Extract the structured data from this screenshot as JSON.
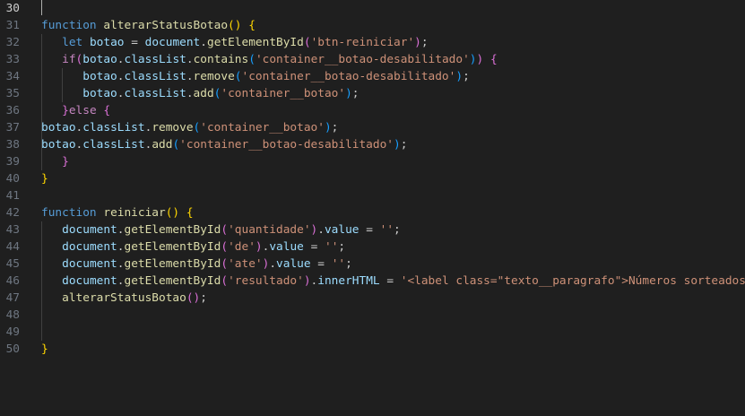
{
  "editor": {
    "colors": {
      "background": "#1f1f1f",
      "keyword": "#569cd6",
      "control": "#c586c0",
      "function": "#dcdcaa",
      "variable": "#9cdcfe",
      "string": "#ce9178",
      "bracket1": "#ffd700",
      "bracket2": "#da70d6",
      "bracket3": "#179fff"
    },
    "lines": [
      {
        "n": "30",
        "active": true,
        "tokens": []
      },
      {
        "n": "31",
        "tokens": [
          [
            "kw",
            "function"
          ],
          [
            "pl",
            " "
          ],
          [
            "fn",
            "alterarStatusBotao"
          ],
          [
            "p1",
            "()"
          ],
          [
            "pl",
            " "
          ],
          [
            "p1",
            "{"
          ]
        ]
      },
      {
        "n": "32",
        "tokens": [
          [
            "pl",
            "   "
          ],
          [
            "kw",
            "let"
          ],
          [
            "pl",
            " "
          ],
          [
            "var",
            "botao"
          ],
          [
            "pl",
            " = "
          ],
          [
            "var",
            "document"
          ],
          [
            "pl",
            "."
          ],
          [
            "fn",
            "getElementById"
          ],
          [
            "p2",
            "("
          ],
          [
            "str",
            "'btn-reiniciar'"
          ],
          [
            "p2",
            ")"
          ],
          [
            "pl",
            ";"
          ]
        ]
      },
      {
        "n": "33",
        "tokens": [
          [
            "pl",
            "   "
          ],
          [
            "kw2",
            "if"
          ],
          [
            "p2",
            "("
          ],
          [
            "var",
            "botao"
          ],
          [
            "pl",
            "."
          ],
          [
            "var",
            "classList"
          ],
          [
            "pl",
            "."
          ],
          [
            "fn",
            "contains"
          ],
          [
            "p3",
            "("
          ],
          [
            "str",
            "'container__botao-desabilitado'"
          ],
          [
            "p3",
            ")"
          ],
          [
            "p2",
            ")"
          ],
          [
            "pl",
            " "
          ],
          [
            "p2",
            "{"
          ]
        ]
      },
      {
        "n": "34",
        "tokens": [
          [
            "pl",
            "      "
          ],
          [
            "var",
            "botao"
          ],
          [
            "pl",
            "."
          ],
          [
            "var",
            "classList"
          ],
          [
            "pl",
            "."
          ],
          [
            "fn",
            "remove"
          ],
          [
            "p3",
            "("
          ],
          [
            "str",
            "'container__botao-desabilitado'"
          ],
          [
            "p3",
            ")"
          ],
          [
            "pl",
            ";"
          ]
        ]
      },
      {
        "n": "35",
        "tokens": [
          [
            "pl",
            "      "
          ],
          [
            "var",
            "botao"
          ],
          [
            "pl",
            "."
          ],
          [
            "var",
            "classList"
          ],
          [
            "pl",
            "."
          ],
          [
            "fn",
            "add"
          ],
          [
            "p3",
            "("
          ],
          [
            "str",
            "'container__botao'"
          ],
          [
            "p3",
            ")"
          ],
          [
            "pl",
            ";"
          ]
        ]
      },
      {
        "n": "36",
        "tokens": [
          [
            "pl",
            "   "
          ],
          [
            "p2",
            "}"
          ],
          [
            "kw2",
            "else"
          ],
          [
            "pl",
            " "
          ],
          [
            "p2",
            "{"
          ]
        ]
      },
      {
        "n": "37",
        "tokens": [
          [
            "var",
            "botao"
          ],
          [
            "pl",
            "."
          ],
          [
            "var",
            "classList"
          ],
          [
            "pl",
            "."
          ],
          [
            "fn",
            "remove"
          ],
          [
            "p3",
            "("
          ],
          [
            "str",
            "'container__botao'"
          ],
          [
            "p3",
            ")"
          ],
          [
            "pl",
            ";"
          ]
        ]
      },
      {
        "n": "38",
        "tokens": [
          [
            "var",
            "botao"
          ],
          [
            "pl",
            "."
          ],
          [
            "var",
            "classList"
          ],
          [
            "pl",
            "."
          ],
          [
            "fn",
            "add"
          ],
          [
            "p3",
            "("
          ],
          [
            "str",
            "'container__botao-desabilitado'"
          ],
          [
            "p3",
            ")"
          ],
          [
            "pl",
            ";"
          ]
        ]
      },
      {
        "n": "39",
        "tokens": [
          [
            "pl",
            "   "
          ],
          [
            "p2",
            "}"
          ]
        ]
      },
      {
        "n": "40",
        "tokens": [
          [
            "p1",
            "}"
          ]
        ]
      },
      {
        "n": "41",
        "tokens": []
      },
      {
        "n": "42",
        "tokens": [
          [
            "kw",
            "function"
          ],
          [
            "pl",
            " "
          ],
          [
            "fn",
            "reiniciar"
          ],
          [
            "p1",
            "()"
          ],
          [
            "pl",
            " "
          ],
          [
            "p1",
            "{"
          ]
        ]
      },
      {
        "n": "43",
        "tokens": [
          [
            "pl",
            "   "
          ],
          [
            "var",
            "document"
          ],
          [
            "pl",
            "."
          ],
          [
            "fn",
            "getElementById"
          ],
          [
            "p2",
            "("
          ],
          [
            "str",
            "'quantidade'"
          ],
          [
            "p2",
            ")"
          ],
          [
            "pl",
            "."
          ],
          [
            "var",
            "value"
          ],
          [
            "pl",
            " = "
          ],
          [
            "str",
            "''"
          ],
          [
            "pl",
            ";"
          ]
        ]
      },
      {
        "n": "44",
        "tokens": [
          [
            "pl",
            "   "
          ],
          [
            "var",
            "document"
          ],
          [
            "pl",
            "."
          ],
          [
            "fn",
            "getElementById"
          ],
          [
            "p2",
            "("
          ],
          [
            "str",
            "'de'"
          ],
          [
            "p2",
            ")"
          ],
          [
            "pl",
            "."
          ],
          [
            "var",
            "value"
          ],
          [
            "pl",
            " = "
          ],
          [
            "str",
            "''"
          ],
          [
            "pl",
            ";"
          ]
        ]
      },
      {
        "n": "45",
        "tokens": [
          [
            "pl",
            "   "
          ],
          [
            "var",
            "document"
          ],
          [
            "pl",
            "."
          ],
          [
            "fn",
            "getElementById"
          ],
          [
            "p2",
            "("
          ],
          [
            "str",
            "'ate'"
          ],
          [
            "p2",
            ")"
          ],
          [
            "pl",
            "."
          ],
          [
            "var",
            "value"
          ],
          [
            "pl",
            " = "
          ],
          [
            "str",
            "''"
          ],
          [
            "pl",
            ";"
          ]
        ]
      },
      {
        "n": "46",
        "tokens": [
          [
            "pl",
            "   "
          ],
          [
            "var",
            "document"
          ],
          [
            "pl",
            "."
          ],
          [
            "fn",
            "getElementById"
          ],
          [
            "p2",
            "("
          ],
          [
            "str",
            "'resultado'"
          ],
          [
            "p2",
            ")"
          ],
          [
            "pl",
            "."
          ],
          [
            "var",
            "innerHTML"
          ],
          [
            "pl",
            " = "
          ],
          [
            "str",
            "'<label class=\"texto__paragrafo\">Números sorteados"
          ]
        ]
      },
      {
        "n": "47",
        "tokens": [
          [
            "pl",
            "   "
          ],
          [
            "fn",
            "alterarStatusBotao"
          ],
          [
            "p2",
            "()"
          ],
          [
            "pl",
            ";"
          ]
        ]
      },
      {
        "n": "48",
        "tokens": []
      },
      {
        "n": "49",
        "tokens": []
      },
      {
        "n": "50",
        "tokens": [
          [
            "p1",
            "}"
          ]
        ]
      }
    ]
  }
}
